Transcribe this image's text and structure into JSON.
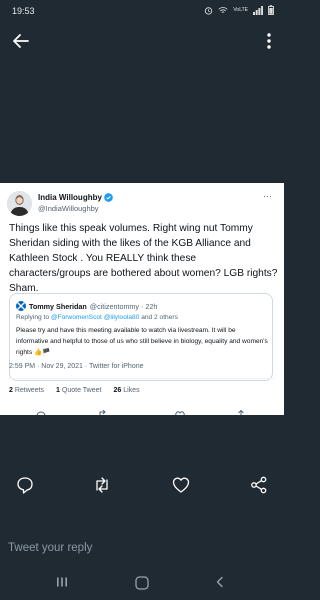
{
  "status_bar": {
    "time": "19:53",
    "signal_label": "VoLTE"
  },
  "tweet": {
    "author": {
      "name": "India Willoughby",
      "handle": "@IndiaWilloughby"
    },
    "text": "Things like this speak volumes. Right wing nut Tommy Sheridan siding with the likes of the KGB Alliance and Kathleen Stock . You REALLY think these characters/groups are bothered about women? LGB rights? Sham.",
    "meta": "2:59 PM · Nov 29, 2021 · Twitter for iPhone",
    "stats": {
      "retweets_count": "2",
      "retweets_label": "Retweets",
      "quotes_count": "1",
      "quotes_label": "Quote Tweet",
      "likes_count": "26",
      "likes_label": "Likes"
    },
    "quoted": {
      "name": "Tommy Sheridan",
      "handle_time": "@citizentommy · 22h",
      "reply_prefix": "Replying to",
      "reply_mentions": "@ForwomenScot @lilyloola80",
      "reply_suffix": "and 2 others",
      "text": "Please try and have this meeting available to watch via livestream. It will be informative and helpful to those of us who still believe in biology, equality and women's rights 👍🏴"
    }
  },
  "reply_placeholder": "Tweet your reply",
  "colors": {
    "background": "#1f2a33",
    "card": "#ffffff",
    "accent": "#1d9bf0",
    "muted": "#536471"
  }
}
